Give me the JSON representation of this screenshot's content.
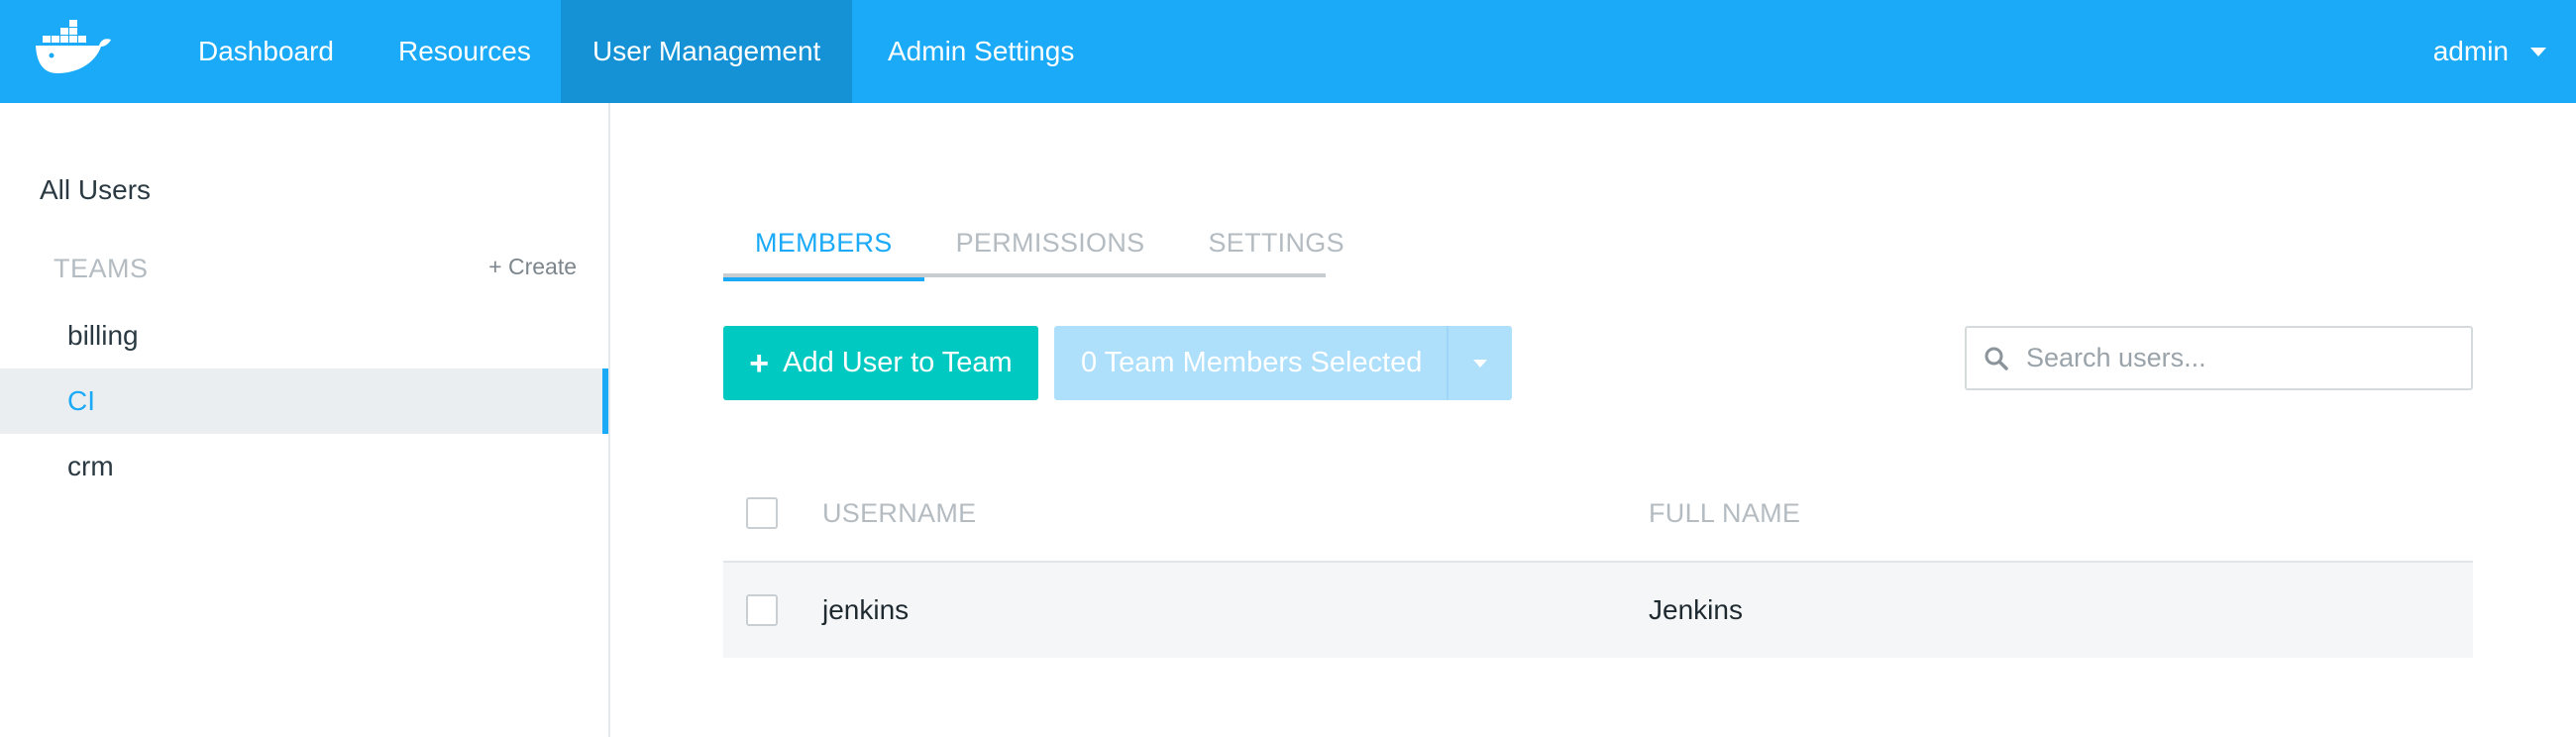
{
  "colors": {
    "nav_bg": "#1aaaf8",
    "nav_active": "#1592d6",
    "accent": "#1aaaf8",
    "add_button": "#00c9c1",
    "selected_button": "#aedffb"
  },
  "topnav": {
    "logo_icon": "docker-whale-icon",
    "items": [
      {
        "label": "Dashboard"
      },
      {
        "label": "Resources"
      },
      {
        "label": "User Management"
      },
      {
        "label": "Admin Settings"
      }
    ],
    "active_index": 2,
    "user": "admin"
  },
  "sidebar": {
    "all_users": "All Users",
    "teams_label": "TEAMS",
    "create_link": "+ Create",
    "teams": [
      {
        "label": "billing"
      },
      {
        "label": "CI"
      },
      {
        "label": "crm"
      }
    ],
    "selected_index": 1
  },
  "tabs": [
    {
      "label": "MEMBERS"
    },
    {
      "label": "PERMISSIONS"
    },
    {
      "label": "SETTINGS"
    }
  ],
  "active_tab": 0,
  "toolbar": {
    "add_icon": "plus-icon",
    "add_label": "Add User to Team",
    "selected_label": "0 Team Members Selected"
  },
  "search": {
    "icon": "search-icon",
    "placeholder": "Search users..."
  },
  "table": {
    "columns": [
      "USERNAME",
      "FULL NAME"
    ],
    "rows": [
      {
        "username": "jenkins",
        "full_name": "Jenkins"
      }
    ]
  }
}
